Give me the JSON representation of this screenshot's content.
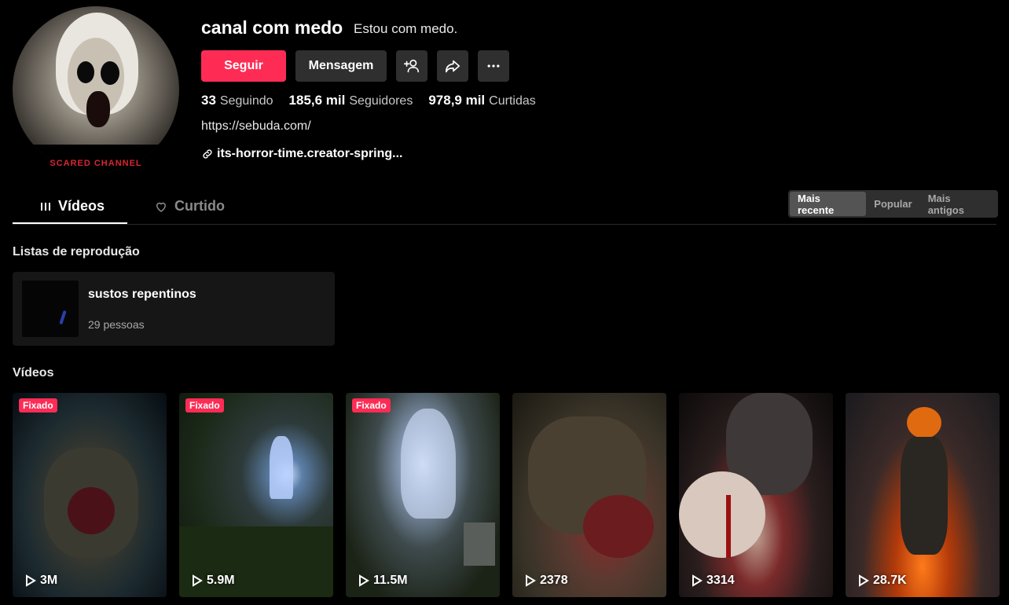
{
  "profile": {
    "username": "canal com medo",
    "nickname": "Estou com medo.",
    "avatar_caption": "SCARED CHANNEL",
    "follow_label": "Seguir",
    "message_label": "Mensagem",
    "add_friend_icon": "add-user-icon",
    "share_icon": "share-icon",
    "more_icon": "more-icon",
    "stats": {
      "following_count": "33",
      "following_label": "Seguindo",
      "followers_count": "185,6 mil",
      "followers_label": "Seguidores",
      "likes_count": "978,9 mil",
      "likes_label": "Curtidas"
    },
    "bio": "https://sebuda.com/",
    "link": "its-horror-time.creator-spring..."
  },
  "tabs": {
    "videos": "Vídeos",
    "liked": "Curtido"
  },
  "sort": {
    "latest": "Mais recente",
    "popular": "Popular",
    "oldest": "Mais antigos",
    "selected": "Mais recente"
  },
  "playlists": {
    "title": "Listas de reprodução",
    "items": [
      {
        "name": "sustos repentinos",
        "count": "29 pessoas"
      }
    ]
  },
  "videos": {
    "title": "Vídeos",
    "pinned_label": "Fixado",
    "items": [
      {
        "views": "3M",
        "pinned": true
      },
      {
        "views": "5.9M",
        "pinned": true
      },
      {
        "views": "11.5M",
        "pinned": true
      },
      {
        "views": "2378",
        "pinned": false
      },
      {
        "views": "3314",
        "pinned": false
      },
      {
        "views": "28.7K",
        "pinned": false
      }
    ]
  },
  "colors": {
    "accent": "#fe2c55",
    "button_bg": "#2f2f2f",
    "background": "#000000"
  }
}
